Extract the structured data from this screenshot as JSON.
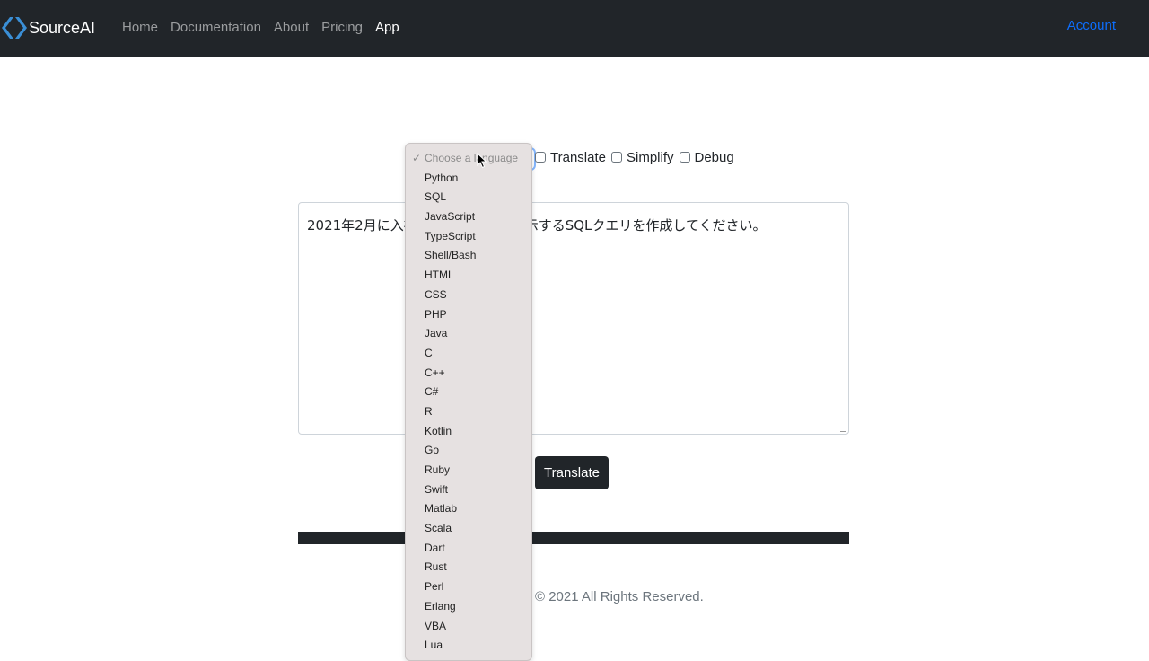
{
  "nav": {
    "brand": "SourceAI",
    "links": [
      {
        "label": "Home",
        "active": false
      },
      {
        "label": "Documentation",
        "active": false
      },
      {
        "label": "About",
        "active": false
      },
      {
        "label": "Pricing",
        "active": false
      },
      {
        "label": "App",
        "active": true
      }
    ],
    "account": "Account"
  },
  "options": {
    "translate": "Translate",
    "simplify": "Simplify",
    "debug": "Debug"
  },
  "prompt": {
    "value": "2021年2月に入社　　　　　　　表示するSQLクエリを作成してください。"
  },
  "translate_button": "Translate",
  "footer": "© 2021 All Rights Reserved.",
  "language_dropdown": {
    "placeholder": "Choose a language",
    "check": "✓",
    "items": [
      "Python",
      "SQL",
      "JavaScript",
      "TypeScript",
      "Shell/Bash",
      "HTML",
      "CSS",
      "PHP",
      "Java",
      "C",
      "C++",
      "C#",
      "R",
      "Kotlin",
      "Go",
      "Ruby",
      "Swift",
      "Matlab",
      "Scala",
      "Dart",
      "Rust",
      "Perl",
      "Erlang",
      "VBA",
      "Lua"
    ]
  },
  "colors": {
    "navbar": "#212529",
    "accent": "#0d6efd",
    "dropdown_bg": "#e6e1e1"
  }
}
